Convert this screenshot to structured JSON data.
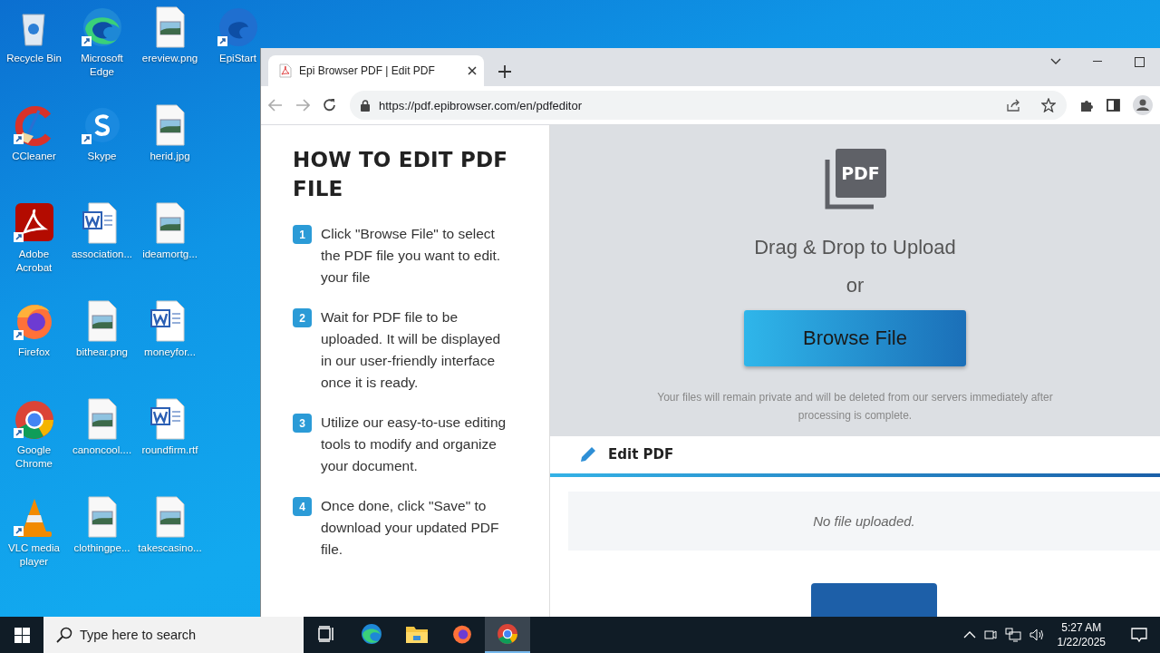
{
  "desktop": {
    "icons": [
      {
        "label": "Recycle Bin",
        "kind": "recycle",
        "shortcut": false
      },
      {
        "label": "CCleaner",
        "kind": "ccleaner",
        "shortcut": true
      },
      {
        "label": "Adobe Acrobat",
        "kind": "acrobat",
        "shortcut": true
      },
      {
        "label": "Firefox",
        "kind": "firefox",
        "shortcut": true
      },
      {
        "label": "Google Chrome",
        "kind": "chrome",
        "shortcut": true
      },
      {
        "label": "VLC media player",
        "kind": "vlc",
        "shortcut": true
      },
      {
        "label": "Microsoft Edge",
        "kind": "edge",
        "shortcut": true
      },
      {
        "label": "Skype",
        "kind": "skype",
        "shortcut": true
      },
      {
        "label": "association...",
        "kind": "word",
        "shortcut": false
      },
      {
        "label": "bithear.png",
        "kind": "image",
        "shortcut": false
      },
      {
        "label": "canoncool....",
        "kind": "image",
        "shortcut": false
      },
      {
        "label": "clothingpe...",
        "kind": "image",
        "shortcut": false
      },
      {
        "label": "ereview.png",
        "kind": "image",
        "shortcut": false
      },
      {
        "label": "herid.jpg",
        "kind": "image",
        "shortcut": false
      },
      {
        "label": "ideamortg...",
        "kind": "image",
        "shortcut": false
      },
      {
        "label": "moneyfor...",
        "kind": "word",
        "shortcut": false
      },
      {
        "label": "roundfirm.rtf",
        "kind": "word",
        "shortcut": false
      },
      {
        "label": "takescasino...",
        "kind": "image",
        "shortcut": false
      },
      {
        "label": "EpiStart",
        "kind": "epistart",
        "shortcut": true
      }
    ]
  },
  "browser": {
    "tab": {
      "title": "Epi Browser PDF | Edit PDF"
    },
    "url": "https://pdf.epibrowser.com/en/pdfeditor",
    "guide": {
      "title": "HOW TO EDIT PDF FILE",
      "steps": [
        {
          "number": "1",
          "text": "Click \"Browse File\" to select the PDF file you want to edit. your file"
        },
        {
          "number": "2",
          "text": "Wait for PDF file to be uploaded. It will be displayed in our user-friendly interface once it is ready."
        },
        {
          "number": "3",
          "text": "Utilize our easy-to-use editing tools to modify and organize your document."
        },
        {
          "number": "4",
          "text": "Once done, click \"Save\" to download your updated PDF file."
        }
      ]
    },
    "upload": {
      "badge": "PDF",
      "heading": "Drag & Drop to Upload",
      "or": "or",
      "button": "Browse File",
      "note": "Your files will remain private and will be deleted from our servers immediately after processing is complete."
    },
    "editor": {
      "title": "Edit PDF",
      "empty": "No file uploaded."
    }
  },
  "taskbar": {
    "search_placeholder": "Type here to search",
    "apps": [
      {
        "kind": "taskview",
        "selected": false
      },
      {
        "kind": "edge",
        "selected": false
      },
      {
        "kind": "folder",
        "selected": false
      },
      {
        "kind": "firefox",
        "selected": false
      },
      {
        "kind": "chrome",
        "selected": true
      }
    ],
    "time": "5:27 AM",
    "date": "1/22/2025"
  }
}
